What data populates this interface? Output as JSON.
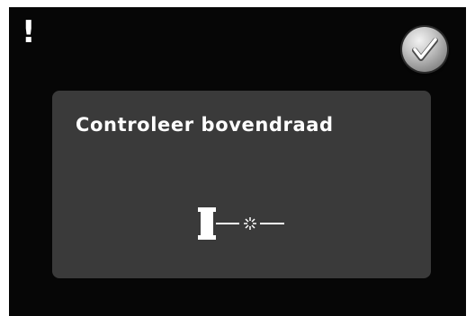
{
  "alert": {
    "symbol": "!"
  },
  "confirm_button": {
    "icon": "checkmark-icon"
  },
  "message": {
    "title": "Controleer bovendraad",
    "icon": "upper-thread-broken-icon"
  },
  "colors": {
    "screen_background": "#060606",
    "panel_background": "#3a3a3a",
    "text": "#ffffff"
  }
}
